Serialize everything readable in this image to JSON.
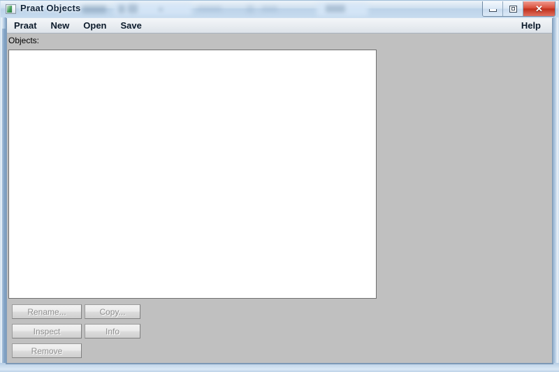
{
  "window": {
    "title": "Praat Objects",
    "icon": "praat-app-icon",
    "controls": {
      "minimize_label": "Minimize",
      "minimize_icon": "minimize-icon",
      "maximize_label": "Maximize",
      "maximize_icon": "maximize-icon",
      "close_label": "Close",
      "close_glyph": "✕",
      "close_color": "#c0301c"
    }
  },
  "menubar": {
    "items": [
      {
        "label": "Praat",
        "name": "menu-praat"
      },
      {
        "label": "New",
        "name": "menu-new"
      },
      {
        "label": "Open",
        "name": "menu-open"
      },
      {
        "label": "Save",
        "name": "menu-save"
      }
    ],
    "help": {
      "label": "Help",
      "name": "menu-help"
    }
  },
  "main": {
    "objects_label": "Objects:",
    "objects_list": {
      "items": [],
      "empty_text": ""
    }
  },
  "buttons": [
    {
      "label": "Rename...",
      "name": "rename-button",
      "enabled": false
    },
    {
      "label": "Copy...",
      "name": "copy-button",
      "enabled": false
    },
    {
      "label": "Inspect",
      "name": "inspect-button",
      "enabled": false
    },
    {
      "label": "Info",
      "name": "info-button",
      "enabled": false
    },
    {
      "label": "Remove",
      "name": "remove-button",
      "enabled": false
    }
  ],
  "colors": {
    "client_background": "#c0c0c0",
    "listbox_background": "#ffffff",
    "titlebar_glass": "#c6dbef",
    "disabled_text": "#8e8e8e"
  }
}
